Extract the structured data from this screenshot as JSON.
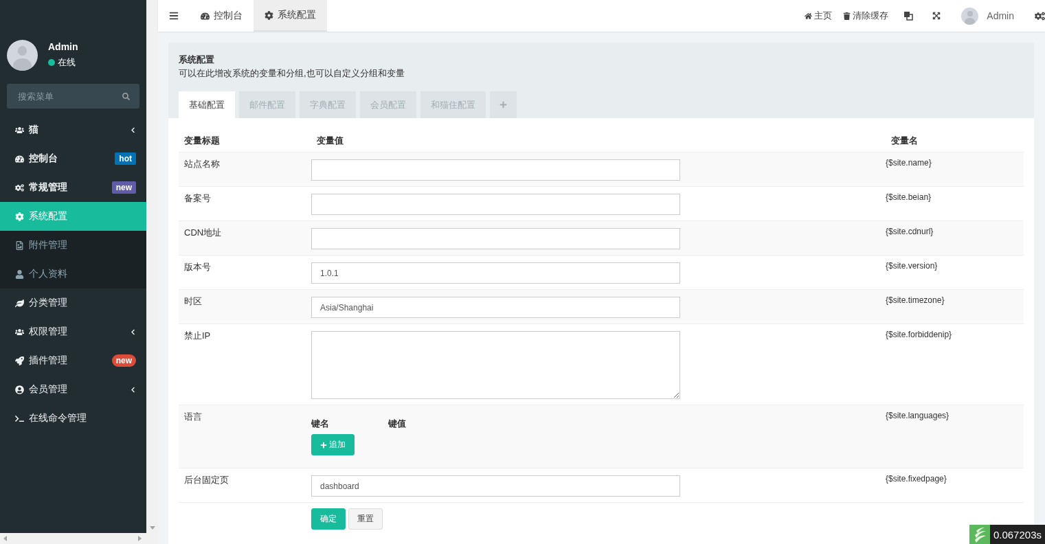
{
  "sidebar": {
    "user": {
      "name": "Admin",
      "status": "在线",
      "online": true
    },
    "search": {
      "placeholder": "搜索菜单"
    },
    "menu": [
      {
        "label": "猫",
        "caret": true,
        "selected": false
      },
      {
        "label": "控制台",
        "badge": {
          "text": "hot",
          "color": "#0073b7",
          "kind": "square"
        },
        "selected": false
      },
      {
        "label": "常规管理",
        "badge": {
          "text": "new",
          "color": "#605ca8",
          "kind": "square"
        },
        "expanded": true,
        "selected": false,
        "children": [
          {
            "label": "系统配置",
            "selected": true
          },
          {
            "label": "附件管理",
            "selected": false
          },
          {
            "label": "个人资料",
            "selected": false
          }
        ]
      },
      {
        "label": "分类管理",
        "selected": false
      },
      {
        "label": "权限管理",
        "caret": true,
        "selected": false
      },
      {
        "label": "插件管理",
        "badge": {
          "text": "new",
          "color": "#dd4b39",
          "kind": "round"
        },
        "selected": false
      },
      {
        "label": "会员管理",
        "caret": true,
        "selected": false
      },
      {
        "label": "在线命令管理",
        "selected": false
      }
    ]
  },
  "header": {
    "tabs": [
      {
        "label": "控制台",
        "selected": false
      },
      {
        "label": "系统配置",
        "selected": true
      }
    ],
    "links": [
      {
        "label": "主页"
      },
      {
        "label": "清除缓存"
      }
    ],
    "user": "Admin"
  },
  "panel": {
    "title": "系统配置",
    "description": "可以在此增改系统的变量和分组,也可以自定义分组和变量",
    "tabs": [
      {
        "label": "基础配置",
        "selected": true
      },
      {
        "label": "邮件配置",
        "selected": false
      },
      {
        "label": "字典配置",
        "selected": false
      },
      {
        "label": "会员配置",
        "selected": false
      },
      {
        "label": "和猫住配置",
        "selected": false
      }
    ],
    "columns": [
      "变量标题",
      "变量值",
      "变量名"
    ],
    "rows": [
      {
        "kind": "input",
        "title": "站点名称",
        "value": "",
        "name": "{$site.name}"
      },
      {
        "kind": "input",
        "title": "备案号",
        "value": "",
        "name": "{$site.beian}"
      },
      {
        "kind": "input",
        "title": "CDN地址",
        "value": "",
        "name": "{$site.cdnurl}"
      },
      {
        "kind": "input",
        "title": "版本号",
        "value": "1.0.1",
        "name": "{$site.version}"
      },
      {
        "kind": "input",
        "title": "时区",
        "value": "Asia/Shanghai",
        "name": "{$site.timezone}"
      },
      {
        "kind": "textarea",
        "title": "禁止IP",
        "value": "",
        "name": "{$site.forbiddenip}"
      },
      {
        "kind": "keyvalue",
        "title": "语言",
        "key_label": "键名",
        "value_label": "键值",
        "button": "追加",
        "name": "{$site.languages}"
      },
      {
        "kind": "input",
        "title": "后台固定页",
        "value": "dashboard",
        "name": "{$site.fixedpage}"
      }
    ],
    "buttons": [
      {
        "label": "确定",
        "kind": "primary"
      },
      {
        "label": "重置",
        "kind": "default"
      }
    ]
  },
  "debug": {
    "time": "0.067203s"
  }
}
